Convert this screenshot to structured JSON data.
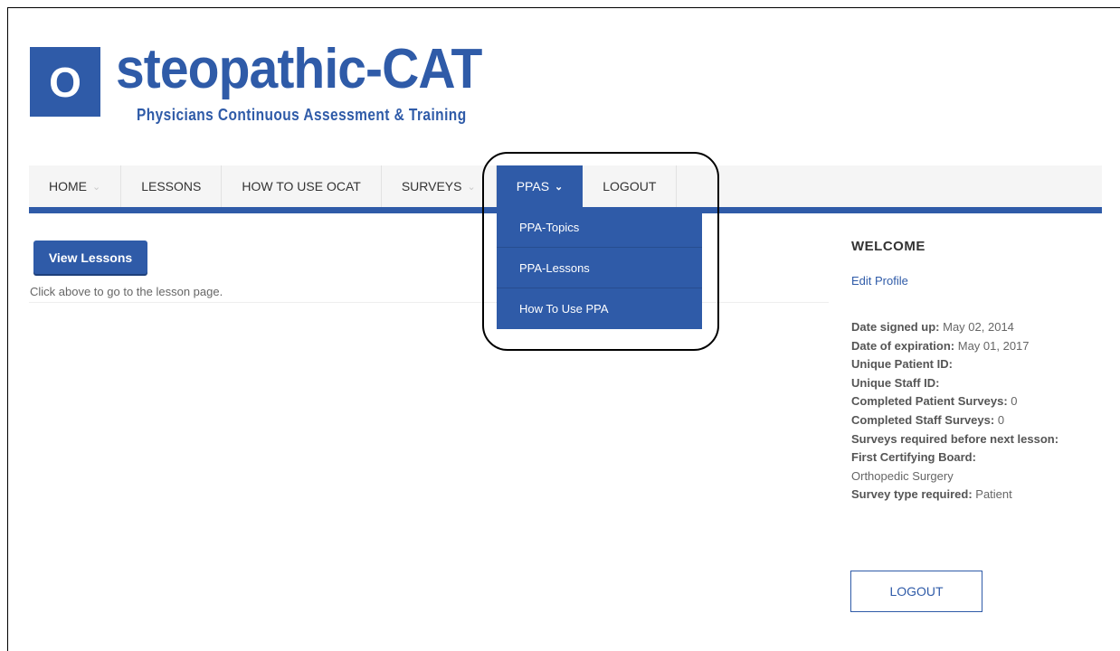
{
  "logo": {
    "letter": "O",
    "title": "steopathic-CAT",
    "subtitle": "Physicians Continuous Assessment & Training"
  },
  "nav": {
    "items": [
      {
        "label": "HOME",
        "has_chevron": true
      },
      {
        "label": "LESSONS"
      },
      {
        "label": "HOW TO USE OCAT"
      },
      {
        "label": "SURVEYS",
        "has_chevron": true
      },
      {
        "label": "PPAS",
        "has_chevron": true,
        "active": true
      },
      {
        "label": "LOGOUT"
      }
    ],
    "chevron": "⌄",
    "dropdown": [
      "PPA-Topics",
      "PPA-Lessons",
      "How To Use PPA"
    ]
  },
  "main": {
    "view_lessons_label": "View Lessons",
    "hint": "Click above to go to the lesson page."
  },
  "sidebar": {
    "welcome": "WELCOME",
    "edit_profile": "Edit Profile",
    "info": [
      {
        "label": "Date signed up:",
        "value": " May 02, 2014"
      },
      {
        "label": "Date of expiration:",
        "value": " May 01, 2017"
      },
      {
        "label": "Unique Patient ID:",
        "value": ""
      },
      {
        "label": "Unique Staff ID:",
        "value": ""
      },
      {
        "label": "Completed Patient Surveys:",
        "value": " 0"
      },
      {
        "label": "Completed Staff Surveys:",
        "value": " 0"
      },
      {
        "label": "Surveys required before next lesson:",
        "value": ""
      },
      {
        "label": "First Certifying Board:",
        "value": ""
      },
      {
        "label": "",
        "value": "Orthopedic Surgery"
      },
      {
        "label": "Survey type required:",
        "value": " Patient"
      }
    ],
    "logout_label": "LOGOUT"
  },
  "colors": {
    "brand": "#2f5ba8"
  }
}
